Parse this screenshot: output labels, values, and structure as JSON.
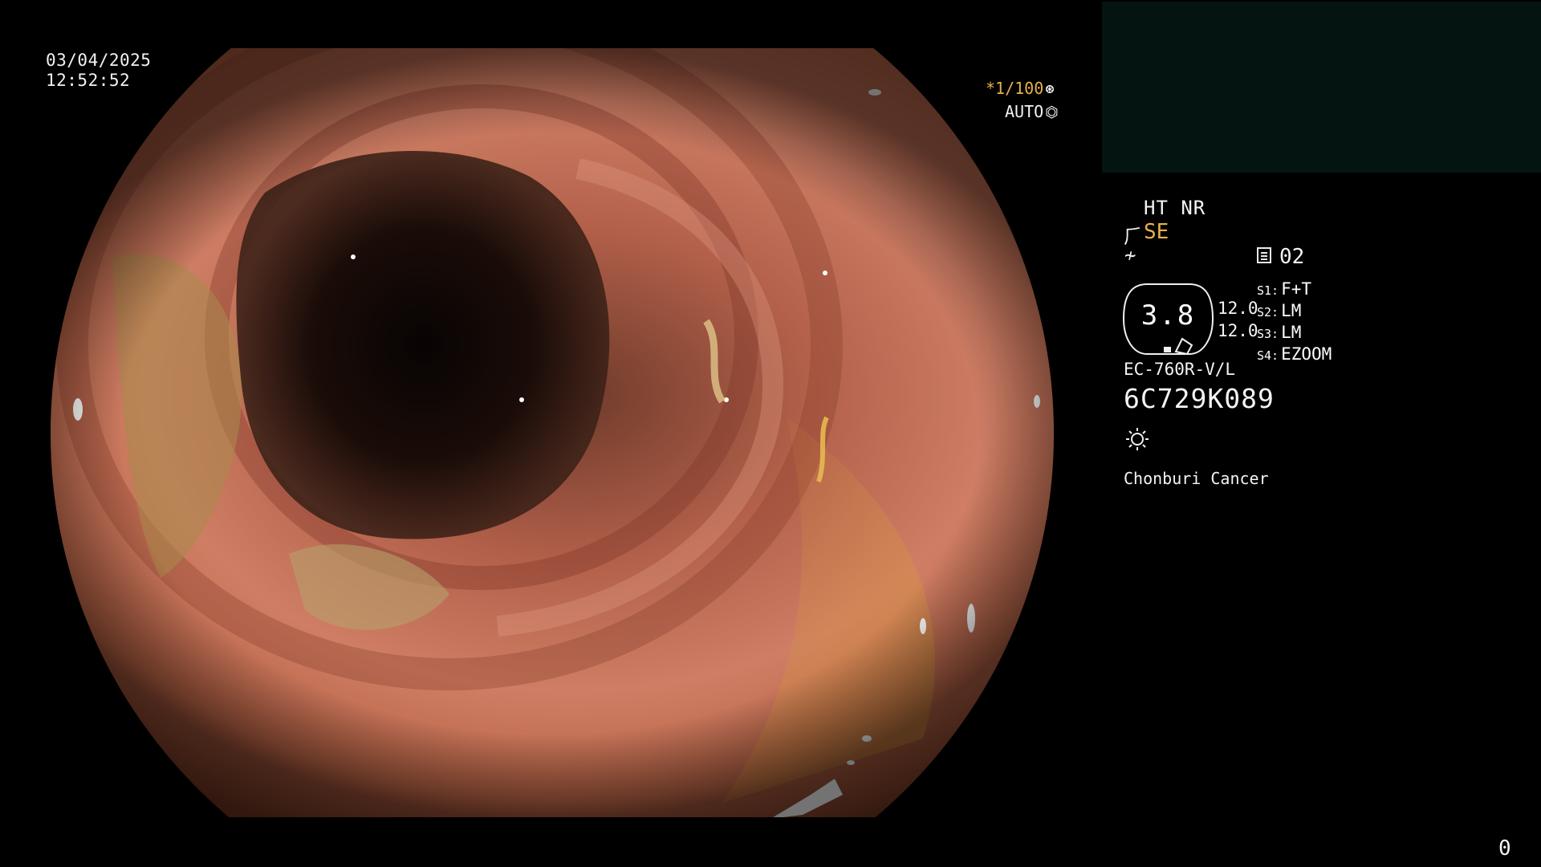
{
  "datetime": {
    "date": "03/04/2025",
    "time": "12:52:52"
  },
  "overlay_top_right": {
    "shutter_value": "*1/100",
    "shutter_icon": "shutter-icon",
    "mode_label": "AUTO",
    "mode_icon": "iris-icon"
  },
  "info_panel": {
    "mode_flags": "HT NR",
    "scope_icon": "scope-icon",
    "enhancement": "SE",
    "wire_icon": "wire-icon",
    "memory_icon": "memory-icon",
    "memory_number": "02",
    "zoom": {
      "value": "3.8",
      "row1": "12.0",
      "row2": "12.0"
    },
    "slots": [
      {
        "key": "S1:",
        "value": "F+T"
      },
      {
        "key": "S2:",
        "value": "LM"
      },
      {
        "key": "S3:",
        "value": "LM"
      },
      {
        "key": "S4:",
        "value": "EZOOM"
      }
    ],
    "scope_model": "EC-760R-V/L",
    "scope_serial": "6C729K089",
    "light_icon": "light-icon",
    "institution": "Chonburi Cancer"
  },
  "footer": {
    "counter": "0"
  },
  "colors": {
    "accent_yellow": "#e6b24a",
    "background": "#000000",
    "thumbnail_panel": "#041410",
    "text": "#f4f4f4"
  }
}
